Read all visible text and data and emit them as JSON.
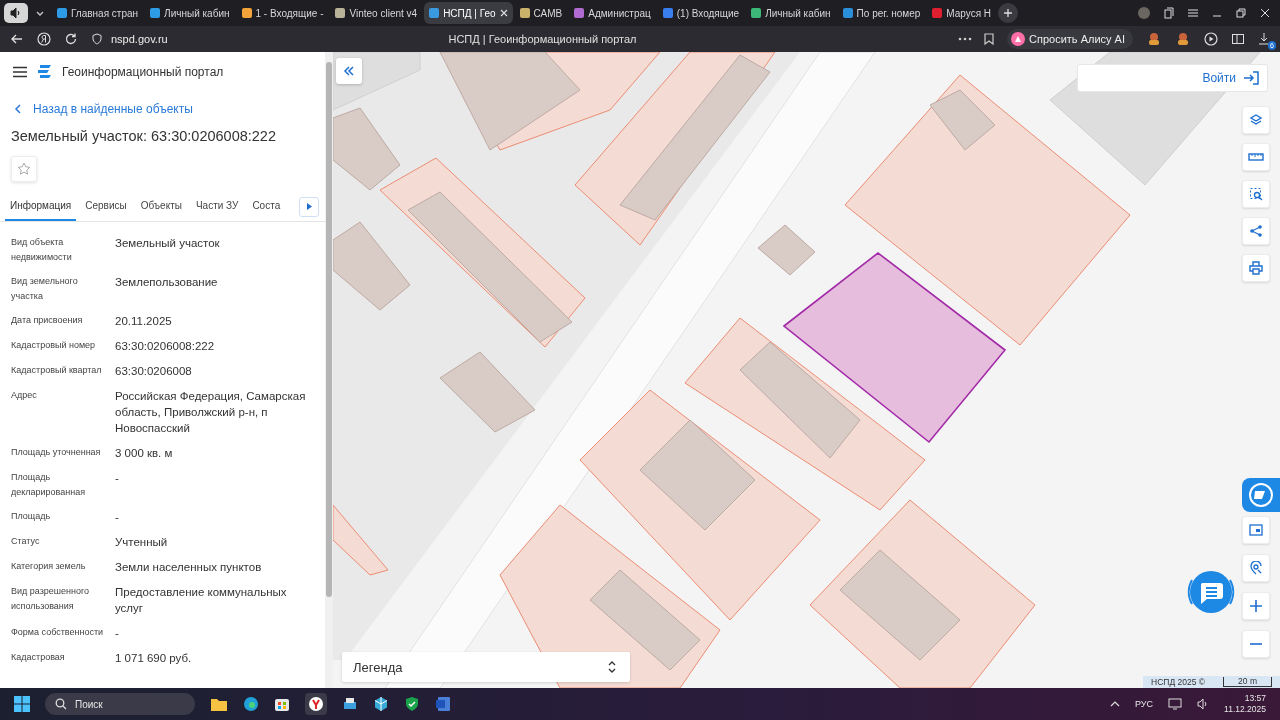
{
  "browser": {
    "tabs": [
      {
        "title": "Главная стран",
        "color": "#2e9be6",
        "selected": false
      },
      {
        "title": "Личный кабин",
        "color": "#2e9be6",
        "selected": false
      },
      {
        "title": "1 - Входящие -",
        "color": "#f2a33a",
        "selected": false
      },
      {
        "title": "Vinteo client v4",
        "color": "#b9b39a",
        "selected": false
      },
      {
        "title": "НСПД | Гео",
        "color": "#3a9ae0",
        "selected": true
      },
      {
        "title": "САМВ",
        "color": "#c9b36a",
        "selected": false
      },
      {
        "title": "Администрац",
        "color": "#b06ad0",
        "selected": false
      },
      {
        "title": "(1) Входящие",
        "color": "#3a7ff0",
        "selected": false
      },
      {
        "title": "Личный кабин",
        "color": "#3cb878",
        "selected": false
      },
      {
        "title": "По рег. номер",
        "color": "#2a8fd8",
        "selected": false
      },
      {
        "title": "Маруся Н",
        "color": "#e02030",
        "selected": false
      }
    ],
    "address": "nspd.gov.ru",
    "page_title": "НСПД | Геоинформационный портал",
    "alice_button": "Спросить Алису AI",
    "extension_badge": "6"
  },
  "panel": {
    "app_title": "Геоинформационный портал",
    "back_link": "Назад в найденные объекты",
    "heading": "Земельный участок: 63:30:0206008:222",
    "favorite": false,
    "tabs": [
      {
        "label": "Информация",
        "selected": true
      },
      {
        "label": "Сервисы",
        "selected": false
      },
      {
        "label": "Объекты",
        "selected": false
      },
      {
        "label": "Части ЗУ",
        "selected": false
      },
      {
        "label": "Соста",
        "selected": false
      }
    ],
    "fields": [
      {
        "label": "Вид объекта недвижимости",
        "value": "Земельный участок"
      },
      {
        "label": "Вид земельного участка",
        "value": "Землепользование"
      },
      {
        "label": "Дата присвоения",
        "value": "20.11.2025"
      },
      {
        "label": "Кадастровый номер",
        "value": "63:30:0206008:222"
      },
      {
        "label": "Кадастровый квартал",
        "value": "63:30:0206008"
      },
      {
        "label": "Адрес",
        "value": "Российская Федерация, Самарская область, Приволжский р-н, п Новоспасский"
      },
      {
        "label": "Площадь уточненная",
        "value": "3 000 кв. м"
      },
      {
        "label": "Площадь декларированная",
        "value": "-"
      },
      {
        "label": "Площадь",
        "value": "-"
      },
      {
        "label": "Статус",
        "value": "Учтенный"
      },
      {
        "label": "Категория земель",
        "value": "Земли населенных пунктов"
      },
      {
        "label": "Вид разрешенного использования",
        "value": "Предоставление коммунальных услуг"
      },
      {
        "label": "Форма собственности",
        "value": "-"
      },
      {
        "label": "Кадастровая",
        "value": "1 071 690 руб."
      }
    ]
  },
  "map": {
    "login_button": "Войти",
    "legend": "Легенда",
    "attribution": "НСПД 2025 ©",
    "scale": "20 m"
  },
  "taskbar": {
    "search": "Поиск",
    "language": "РУС",
    "time": "13:57",
    "date": "11.12.2025"
  }
}
